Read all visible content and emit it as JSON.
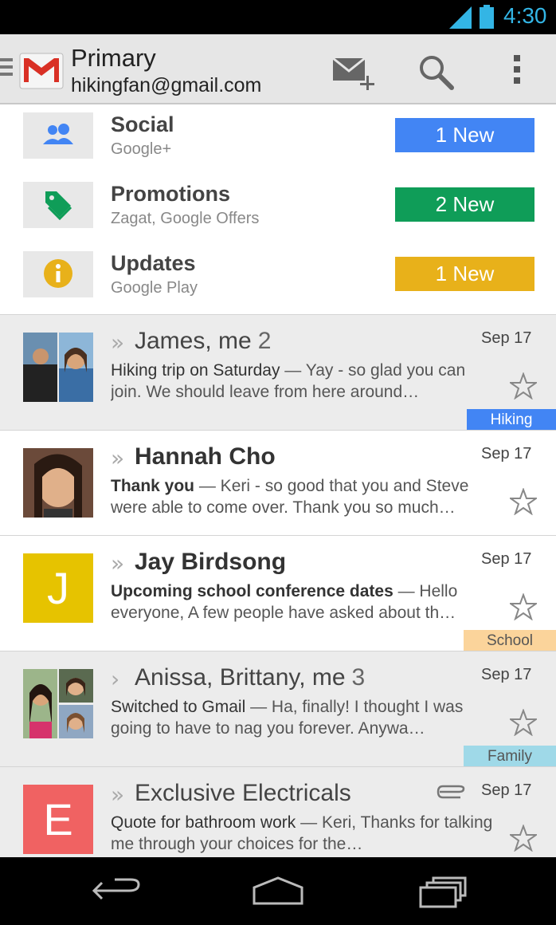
{
  "status_bar": {
    "time": "4:30",
    "accent_color": "#33b5e5"
  },
  "action_bar": {
    "title": "Primary",
    "account": "hikingfan@gmail.com",
    "icons": [
      "menu-icon",
      "gmail-logo",
      "compose-icon",
      "search-icon",
      "overflow-menu-icon"
    ]
  },
  "categories": [
    {
      "title": "Social",
      "subtitle": "Google+",
      "badge": "1 New",
      "color": "#4285f4",
      "icon": "people-icon"
    },
    {
      "title": "Promotions",
      "subtitle": "Zagat, Google Offers",
      "badge": "2 New",
      "color": "#0f9d58",
      "icon": "tag-icon"
    },
    {
      "title": "Updates",
      "subtitle": "Google Play",
      "badge": "1 New",
      "color": "#e8b11a",
      "icon": "info-icon"
    }
  ],
  "emails": [
    {
      "sender": "James, me",
      "count": "2",
      "date": "Sep 17",
      "subject": "Hiking trip on Saturday",
      "snippet": " — Yay - so glad you can join. We should leave from here around…",
      "label": "Hiking",
      "label_bg": "#4285f4",
      "label_fg": "#ffffff",
      "read": true
    },
    {
      "sender": "Hannah Cho",
      "count": "",
      "date": "Sep 17",
      "subject": "Thank you",
      "snippet": " — Keri - so good that you and Steve were able to come over. Thank you so much…",
      "label": "",
      "read": false
    },
    {
      "sender": "Jay Birdsong",
      "count": "",
      "date": "Sep 17",
      "subject": "Upcoming school conference dates",
      "snippet": " — Hello everyone, A few people have asked about th…",
      "label": "School",
      "label_bg": "#fbd49b",
      "label_fg": "#555555",
      "read": false,
      "avatar_letter": "J",
      "avatar_color": "#e6c300"
    },
    {
      "sender": "Anissa, Brittany, me",
      "count": "3",
      "date": "Sep 17",
      "subject": "Switched to Gmail",
      "snippet": " — Ha, finally! I thought I was going to have to nag you forever. Anywa…",
      "label": "Family",
      "label_bg": "#9fd9e8",
      "label_fg": "#555555",
      "read": true
    },
    {
      "sender": "Exclusive Electricals",
      "count": "",
      "date": "Sep 17",
      "subject": "Quote for bathroom work",
      "snippet": " — Keri, Thanks for talking me through your choices for the…",
      "label": "",
      "read": true,
      "avatar_letter": "E",
      "avatar_color": "#f06262",
      "attachment": true
    }
  ],
  "nav_bar": {
    "buttons": [
      "back-icon",
      "home-icon",
      "recent-apps-icon"
    ]
  }
}
